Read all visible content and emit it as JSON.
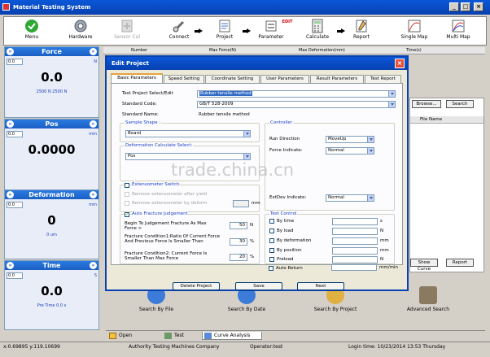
{
  "window": {
    "title": "Material Testing System"
  },
  "toolbar": {
    "menu": "Menu",
    "hardware": "Hardware",
    "sensor_cal": "Sensor Cal",
    "connect": "Connect",
    "project": "Project",
    "parameter": "Parameter",
    "calculate": "Calculate",
    "report": "Report",
    "single_map": "Single Map",
    "multi_map": "Multi Map"
  },
  "panels": {
    "force": {
      "title": "Force",
      "zero": "0.0",
      "unit": "N",
      "value": "0.0",
      "range": "2500 N 2500 N"
    },
    "pos": {
      "title": "Pos",
      "zero": "0.0",
      "unit": "mm",
      "value": "0.0000"
    },
    "deformation": {
      "title": "Deformation",
      "zero": "0.0",
      "unit": "mm",
      "value": "0",
      "sub": "0 um"
    },
    "time": {
      "title": "Time",
      "zero": "0.0",
      "unit": "S",
      "value": "0.0",
      "sub": "Pre Time 0.0 s"
    }
  },
  "table": {
    "headers": [
      "Number",
      "Max Force(N)",
      "Max Deformation(mm)",
      "Time(s)"
    ]
  },
  "right": {
    "browse": "Browse...",
    "search": "Search",
    "file_name": "File Name",
    "show_curve": "Show Curve",
    "report": "Report"
  },
  "dialog": {
    "title": "Edit Project",
    "tabs": [
      "Basic Parameters",
      "Speed Setting",
      "Coordinate Setting",
      "User Parameters",
      "Result Parameters",
      "Test Report"
    ],
    "test_project_label": "Test Project Select/Edit",
    "test_project_value": "Rubber tensile method",
    "standard_code_label": "Standard Code:",
    "standard_code_value": "GB/T 528-2009",
    "standard_name_label": "Standard Name:",
    "standard_name_value": "Rubber tensile method",
    "sample_shape_label": "Sample Shape :",
    "sample_shape_value": "Board",
    "deform_calc_label": "Deformation Calculate Select:",
    "deform_calc_value": "Pos",
    "extensometer_label": "Extensometer Switch",
    "remove_ext_yield": "Remove extensometer after yield",
    "remove_ext_deform": "Remove extensometer by deform",
    "remove_ext_unit": "mm",
    "fracture_label": "Auto Fracture Judgement",
    "fracture_begin": "Begin To Judgement Fracture As Max Force >",
    "fracture_begin_val": "50",
    "fracture_begin_unit": "N",
    "fracture_cond1": "Fracture Condition1:Ratio Of Current Force And Previous Force Is Smaller Than",
    "fracture_cond1_val": "30",
    "fracture_cond1_unit": "%",
    "fracture_cond2": "Fracture Condition2: Current Force Is Smaller Than Max Force",
    "fracture_cond2_val": "20",
    "fracture_cond2_unit": "%",
    "controller_label": "Controller",
    "run_direction_label": "Run Direction",
    "run_direction_value": "MoveUp",
    "force_indicate_label": "Force Indicate:",
    "force_indicate_value": "Normal",
    "extdev_label": "ExtDev Indicate:",
    "extdev_value": "Normal",
    "test_control_label": "Test Control",
    "by_time": "By time",
    "by_time_unit": "s",
    "by_load": "By load",
    "by_load_unit": "N",
    "by_deformation": "By deformation",
    "by_deformation_unit": "mm",
    "by_position": "By position",
    "by_position_unit": "mm",
    "preload": "Preload",
    "preload_unit": "N",
    "auto_return": "Auto Return",
    "auto_return_unit": "mm/min",
    "delete_project": "Delete Project",
    "save": "Save",
    "next": "Next"
  },
  "search": {
    "by_file": "Search By File",
    "by_date": "Search By Date",
    "by_project": "Search By Project",
    "advanced": "Advanced Search"
  },
  "bottom_tabs": [
    "Open",
    "Test",
    "Curve Analysis"
  ],
  "status": {
    "coords": "x:0.69895 y:119.10699",
    "company": "Authority Testing Machines Company",
    "operator": "Operator:test",
    "login": "Login time: 10/23/2014 13:53 Thursday"
  },
  "watermark": "trade.china.cn",
  "colors": {
    "title_blue": "#0a57d8",
    "panel_head": "#2a7be0",
    "accent_orange": "#e6a23c"
  }
}
